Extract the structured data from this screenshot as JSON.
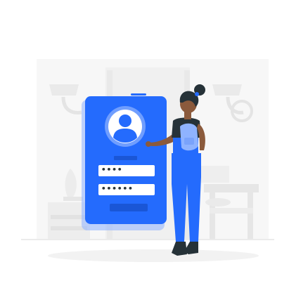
{
  "illustration": {
    "subject": "login",
    "password_field_1": "••••",
    "password_field_2": "••••••",
    "colors": {
      "accent": "#246BFD",
      "accent_dark": "#1A56D6",
      "accent_light": "#8FB3FF",
      "dark": "#263238",
      "skin": "#8B5A3C",
      "background_shapes": "#F2F2F2",
      "background_shapes_dark": "#E6E6E6",
      "white": "#FFFFFF"
    },
    "icons": [
      "user-avatar-icon",
      "phone-device",
      "person-figure",
      "backpack"
    ]
  }
}
